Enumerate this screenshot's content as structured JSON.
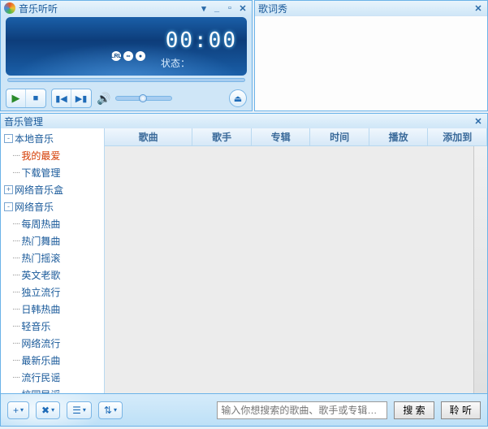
{
  "player": {
    "title": "音乐听听",
    "time": "00:00",
    "status_label": "状态：",
    "indicators": [
      "LRL",
      "∞",
      "●"
    ]
  },
  "lyrics": {
    "title": "歌词秀"
  },
  "mgmt": {
    "title": "音乐管理",
    "columns": [
      "歌曲",
      "歌手",
      "专辑",
      "时间",
      "播放",
      "添加到"
    ],
    "tree": [
      {
        "label": "本地音乐",
        "expander": "-",
        "children": [
          {
            "label": "我的最爱",
            "selected": true
          },
          {
            "label": "下载管理"
          }
        ]
      },
      {
        "label": "网络音乐盒",
        "expander": "+"
      },
      {
        "label": "网络音乐",
        "expander": "-",
        "children": [
          {
            "label": "每周热曲"
          },
          {
            "label": "热门舞曲"
          },
          {
            "label": "热门摇滚"
          },
          {
            "label": "英文老歌"
          },
          {
            "label": "独立流行"
          },
          {
            "label": "日韩热曲"
          },
          {
            "label": "轻音乐"
          },
          {
            "label": "网络流行"
          },
          {
            "label": "最新乐曲"
          },
          {
            "label": "流行民谣"
          },
          {
            "label": "校园民谣"
          }
        ]
      }
    ]
  },
  "bottom": {
    "add_btn": "+",
    "delete_btn": "✖",
    "list_btn": "☰",
    "sort_btn": "⇅",
    "search_placeholder": "输入你想搜索的歌曲、歌手或专辑…",
    "search_btn": "搜 索",
    "listen_btn": "聆 听"
  }
}
